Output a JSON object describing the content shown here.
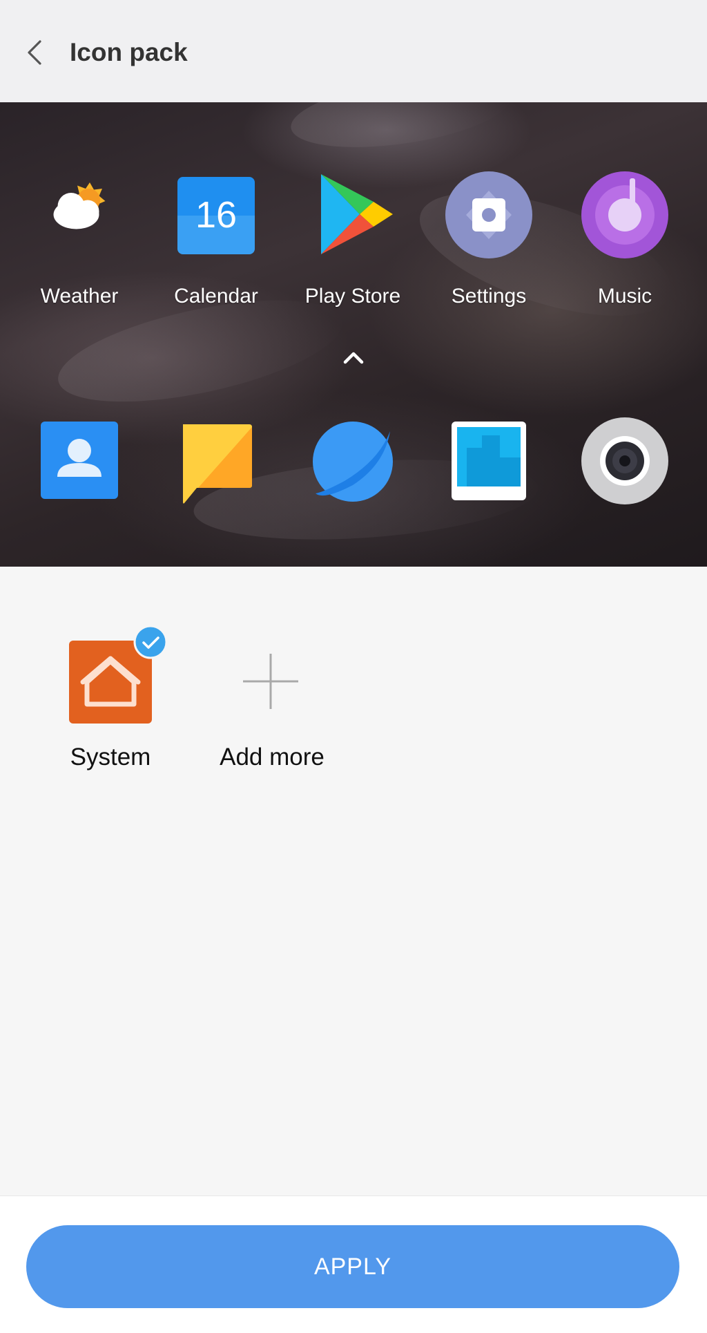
{
  "header": {
    "title": "Icon pack"
  },
  "preview": {
    "row1": [
      {
        "label": "Weather",
        "icon": "weather-icon"
      },
      {
        "label": "Calendar",
        "icon": "calendar-icon",
        "day": "16"
      },
      {
        "label": "Play Store",
        "icon": "play-store-icon"
      },
      {
        "label": "Settings",
        "icon": "settings-icon"
      },
      {
        "label": "Music",
        "icon": "music-icon"
      }
    ],
    "row2": [
      {
        "icon": "contacts-icon"
      },
      {
        "icon": "notes-icon"
      },
      {
        "icon": "browser-icon"
      },
      {
        "icon": "gallery-icon"
      },
      {
        "icon": "camera-icon"
      }
    ]
  },
  "packs": [
    {
      "label": "System",
      "selected": true,
      "icon": "home-icon"
    },
    {
      "label": "Add more",
      "icon": "plus-icon"
    }
  ],
  "footer": {
    "apply_label": "APPLY"
  },
  "colors": {
    "accent": "#5298ec",
    "system_pack": "#e2611f",
    "check_badge": "#3aa3ec"
  }
}
